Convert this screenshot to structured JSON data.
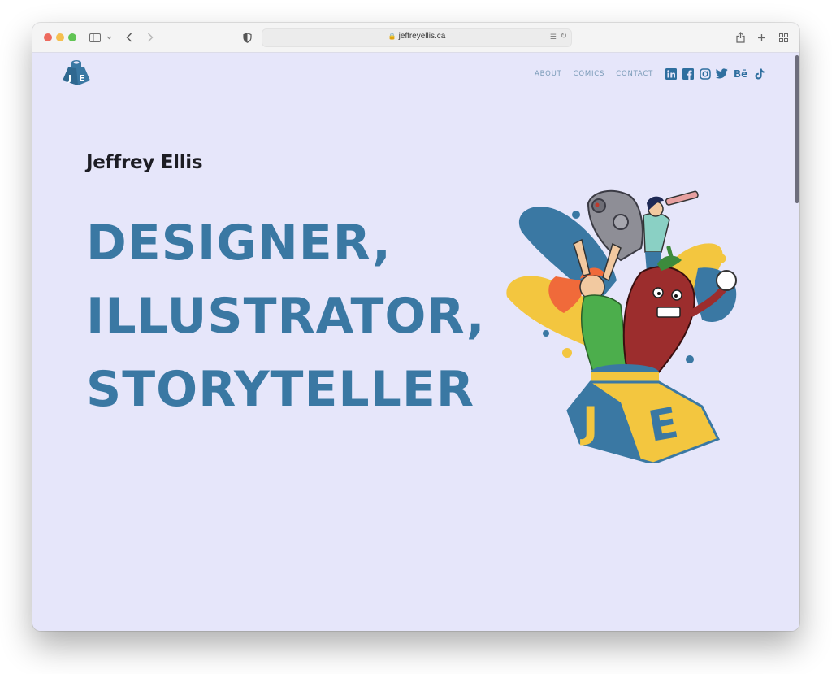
{
  "browser": {
    "url": "jeffreyellis.ca",
    "icons": {
      "sidebar": "sidebar-icon",
      "sidebar_menu": "chevron-down-icon",
      "back": "back-arrow-icon",
      "forward": "forward-arrow-icon",
      "privacy": "shield-icon",
      "lock": "lock-icon",
      "translate": "translate-icon",
      "reload": "reload-icon",
      "share": "share-icon",
      "new_tab": "plus-icon",
      "tab_overview": "tab-grid-icon"
    }
  },
  "site": {
    "logo_alt": "JE",
    "nav": [
      {
        "label": "ABOUT"
      },
      {
        "label": "COMICS"
      },
      {
        "label": "CONTACT"
      }
    ],
    "social": [
      {
        "name": "linkedin-icon",
        "label": "in"
      },
      {
        "name": "facebook-icon",
        "label": "f"
      },
      {
        "name": "instagram-icon",
        "label": ""
      },
      {
        "name": "twitter-icon",
        "label": ""
      },
      {
        "name": "behance-icon",
        "label": "Bē"
      },
      {
        "name": "tiktok-icon",
        "label": "♪"
      }
    ],
    "name": "Jeffrey Ellis",
    "headline": [
      "DESIGNER,",
      "ILLUSTRATOR,",
      "STORYTELLER"
    ],
    "hero_letters": [
      "J",
      "E"
    ]
  },
  "colors": {
    "page_bg": "#e6e6fa",
    "brand_blue": "#3a78a3",
    "brand_yellow": "#f3c63f",
    "nav_text": "#7a9bb8",
    "social_icon": "#2f6f9f"
  }
}
